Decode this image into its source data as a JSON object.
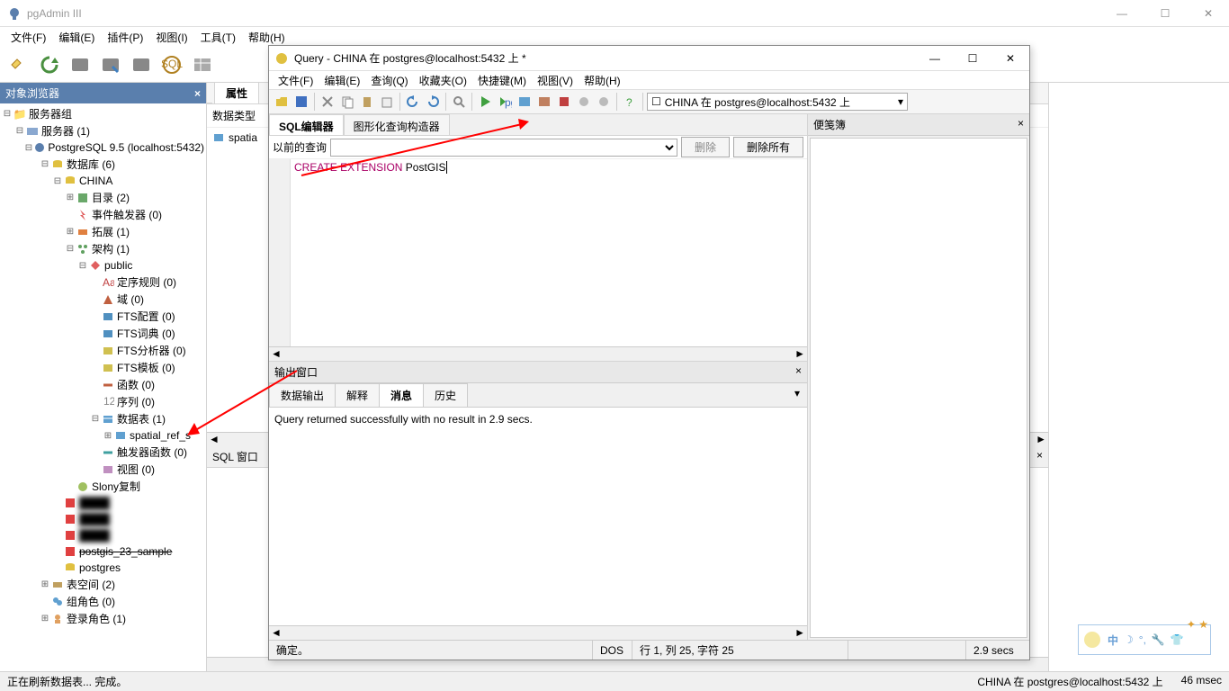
{
  "app": {
    "title": "pgAdmin III"
  },
  "menus": {
    "main": [
      "文件(F)",
      "编辑(E)",
      "插件(P)",
      "视图(I)",
      "工具(T)",
      "帮助(H)"
    ]
  },
  "sidebar": {
    "header": "对象浏览器",
    "root": "服务器组",
    "servers": "服务器 (1)",
    "server": "PostgreSQL 9.5 (localhost:5432)",
    "databases": "数据库 (6)",
    "db_china": "CHINA",
    "catalog": "目录 (2)",
    "triggers": "事件触发器 (0)",
    "ext": "拓展 (1)",
    "schema": "架构 (1)",
    "public": "public",
    "rules": "定序规则 (0)",
    "domain": "域 (0)",
    "ftsconf": "FTS配置 (0)",
    "ftsdict": "FTS词典 (0)",
    "ftsparser": "FTS分析器 (0)",
    "ftstmpl": "FTS模板 (0)",
    "func": "函数 (0)",
    "seq": "序列 (0)",
    "tables": "数据表 (1)",
    "spatial": "spatial_ref_s",
    "trigfunc": "触发器函数 (0)",
    "views": "视图 (0)",
    "slony": "Slony复制",
    "sample": "postgis_23_sample",
    "postgres": "postgres",
    "tablespace": "表空间 (2)",
    "grprole": "组角色 (0)",
    "loginrole": "登录角色 (1)"
  },
  "center": {
    "tab_props": "属性",
    "col_data_types": "数据类型",
    "row_spatial": "spatia",
    "sql_header": "SQL 窗口"
  },
  "query": {
    "title": "Query - CHINA 在  postgres@localhost:5432 上 *",
    "menus": [
      "文件(F)",
      "编辑(E)",
      "查询(Q)",
      "收藏夹(O)",
      "快捷键(M)",
      "视图(V)",
      "帮助(H)"
    ],
    "conn": "CHINA 在  postgres@localhost:5432 上",
    "tab_editor": "SQL编辑器",
    "tab_graphical": "图形化查询构造器",
    "prev_label": "前的查询",
    "btn_delete": "删除",
    "btn_delete_all": "删除所有",
    "editor_kw": "CREATE EXTENSION",
    "editor_rest": " PostGIS",
    "notepad": "便笺簿",
    "output_header": "输出窗口",
    "tab_dataout": "数据输出",
    "tab_explain": "解释",
    "tab_messages": "消息",
    "tab_history": "历史",
    "output_text": "Query returned successfully with no result in 2.9 secs.",
    "status_ok": "确定。",
    "status_enc": "DOS",
    "status_rowcol": "行 1, 列 25, 字符 25",
    "status_time": "2.9 secs"
  },
  "statusbar": {
    "left": "正在刷新数据表... 完成。",
    "conn": "CHINA 在  postgres@localhost:5432 上",
    "time": "46 msec"
  },
  "ime": {
    "zhong": "中"
  }
}
